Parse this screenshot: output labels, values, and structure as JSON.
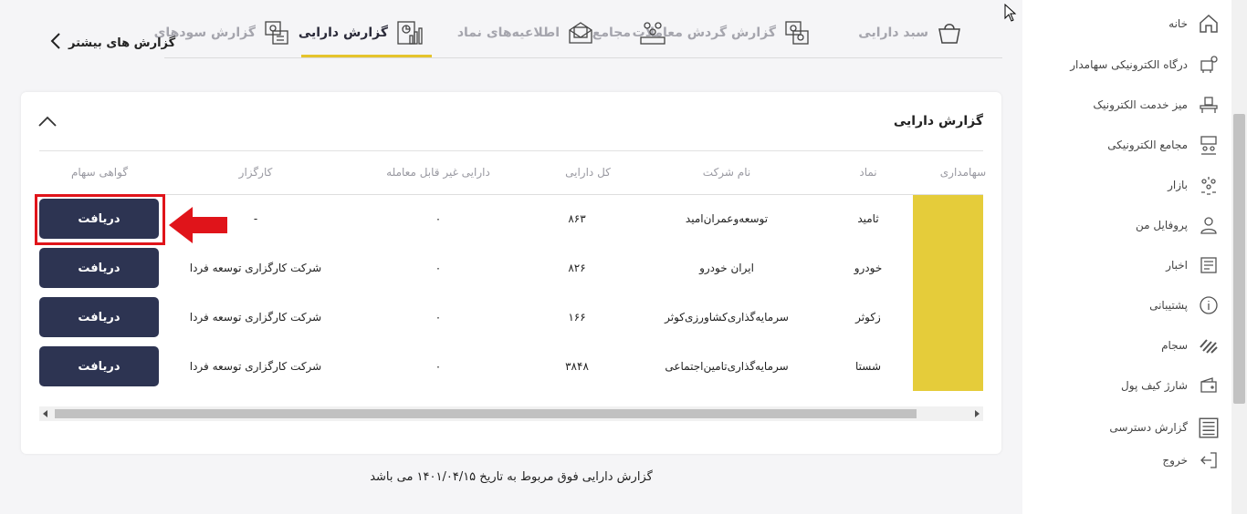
{
  "sidebar": {
    "items": [
      {
        "label": "خانه",
        "icon": "home-icon"
      },
      {
        "label": "درگاه الکترونیکی سهامدار",
        "icon": "shareholder-portal-icon"
      },
      {
        "label": "میز خدمت الکترونیک",
        "icon": "service-desk-icon"
      },
      {
        "label": "مجامع الکترونیکی",
        "icon": "electronic-assembly-icon"
      },
      {
        "label": "بازار",
        "icon": "market-icon"
      },
      {
        "label": "پروفایل من",
        "icon": "profile-icon"
      },
      {
        "label": "اخبار",
        "icon": "news-icon"
      },
      {
        "label": "پشتیبانی",
        "icon": "info-icon"
      },
      {
        "label": "سجام",
        "icon": "sejam-icon"
      },
      {
        "label": "شارژ کیف پول",
        "icon": "wallet-icon"
      },
      {
        "label": "گزارش دسترسی",
        "icon": "access-report-icon"
      },
      {
        "label": "خروج",
        "icon": "logout-icon"
      }
    ]
  },
  "tabs": [
    {
      "label": "سبد دارایی",
      "icon": "basket-icon"
    },
    {
      "label": "گزارش گردش معاملات",
      "icon": "transactions-report-icon"
    },
    {
      "label": "مجامع",
      "icon": "assembly-icon"
    },
    {
      "label": "اطلاعیه‌های نماد",
      "icon": "announcement-icon"
    },
    {
      "label": "گزارش دارایی",
      "icon": "asset-report-icon",
      "active": true
    },
    {
      "label": "گزارش سودهای",
      "icon": "dividend-report-icon"
    }
  ],
  "more_reports": "گزارش های بیشتر",
  "card": {
    "title": "گزارش دارایی",
    "columns": [
      "سهامداری",
      "نماد",
      "نام شرکت",
      "کل دارایی",
      "دارایی غیر قابل معامله",
      "کارگزار",
      "گواهی سهام"
    ],
    "rows": [
      {
        "symbol": "ثامید",
        "company": "توسعه‌وعمران‌امید",
        "total": "۸۶۳",
        "non_tradable": "۰",
        "broker": "-",
        "action": "دریافت"
      },
      {
        "symbol": "خودرو",
        "company": "ایران خودرو",
        "total": "۸۲۶",
        "non_tradable": "۰",
        "broker": "شرکت کارگزاری توسعه فردا",
        "action": "دریافت"
      },
      {
        "symbol": "زکوثر",
        "company": "سرمایه‌گذاری‌کشاورزی‌کوثر",
        "total": "۱۶۶",
        "non_tradable": "۰",
        "broker": "شرکت کارگزاری توسعه فردا",
        "action": "دریافت"
      },
      {
        "symbol": "شستا",
        "company": "سرمایه‌گذاری‌تامین‌اجتماعی",
        "total": "۳۸۴۸",
        "non_tradable": "۰",
        "broker": "شرکت کارگزاری توسعه فردا",
        "action": "دریافت"
      }
    ]
  },
  "footnote": "گزارش دارایی فوق مربوط به تاریخ ۱۴۰۱/۰۴/۱۵ می باشد",
  "colors": {
    "accent": "#e5c42c",
    "button": "#2d3452",
    "highlight": "#e0141a"
  }
}
